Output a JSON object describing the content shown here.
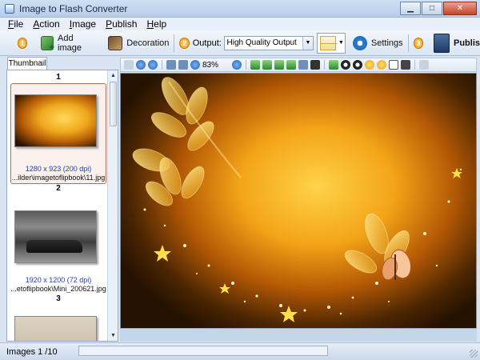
{
  "window": {
    "title": "Image to Flash Converter"
  },
  "menu": [
    {
      "label": "File",
      "accel": "F",
      "rest": "ile"
    },
    {
      "label": "Action",
      "accel": "A",
      "rest": "ction"
    },
    {
      "label": "Image",
      "accel": "I",
      "rest": "mage"
    },
    {
      "label": "Publish",
      "accel": "P",
      "rest": "ublish"
    },
    {
      "label": "Help",
      "accel": "H",
      "rest": "elp"
    }
  ],
  "toolbar": {
    "step1": "1",
    "add_image_label": "Add image",
    "decoration_label": "Decoration",
    "step2": "2",
    "output_label": "Output:",
    "output_value": "High Quality Output",
    "settings_label": "Settings",
    "step3": "3",
    "publish_label": "Publis"
  },
  "thumbnail_panel": {
    "tab_label": "Thumbnail",
    "items": [
      {
        "num": "1",
        "size": "1280 x 923 (200 dpi)",
        "path": "...ilder\\imagetoflipbook\\11.jpg"
      },
      {
        "num": "2",
        "size": "1920 x 1200 (72 dpi)",
        "path": "...etoflipbook\\Mini_200621.jpg"
      },
      {
        "num": "3"
      }
    ]
  },
  "image_toolbar": {
    "zoom": "83%"
  },
  "status": {
    "text": "Images 1 /10"
  },
  "colors": {
    "accent": "#2e7ed6",
    "step_badge": "#f19a12",
    "selected_border": "#c06a4d"
  }
}
